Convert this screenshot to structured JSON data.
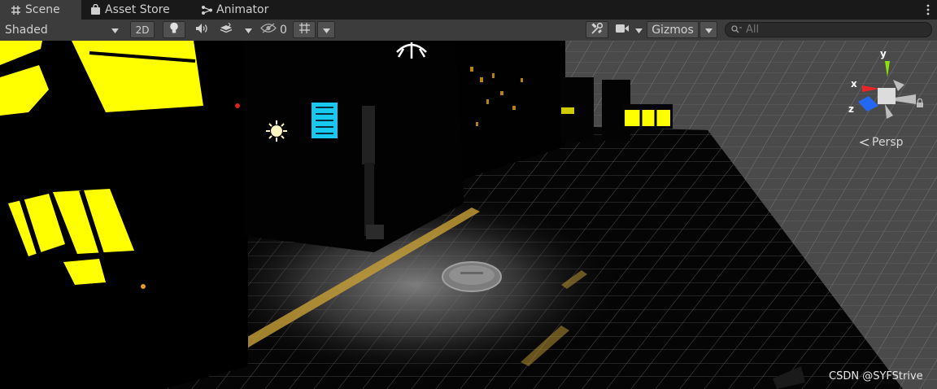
{
  "tabs": [
    {
      "label": "Scene",
      "icon": "grid-icon",
      "active": true
    },
    {
      "label": "Asset Store",
      "icon": "shopping-bag-icon",
      "active": false
    },
    {
      "label": "Animator",
      "icon": "animator-icon",
      "active": false
    }
  ],
  "toolbar": {
    "shading_mode": "Shaded",
    "mode_2d": "2D",
    "hidden_count": "0",
    "gizmos": "Gizmos",
    "search_placeholder": "All"
  },
  "viewport": {
    "gizmo_axes": {
      "x": "x",
      "y": "y",
      "z": "z"
    },
    "projection": "Persp",
    "watermark": "CSDN @SYFStrive"
  },
  "colors": {
    "tab_bar": "#191919",
    "toolbar": "#3c3c3c",
    "building_window": "#ffff00",
    "road_line": "#c8a034",
    "axis_x": "#e8262a",
    "axis_y": "#8ce00b",
    "axis_z": "#2468f2"
  }
}
